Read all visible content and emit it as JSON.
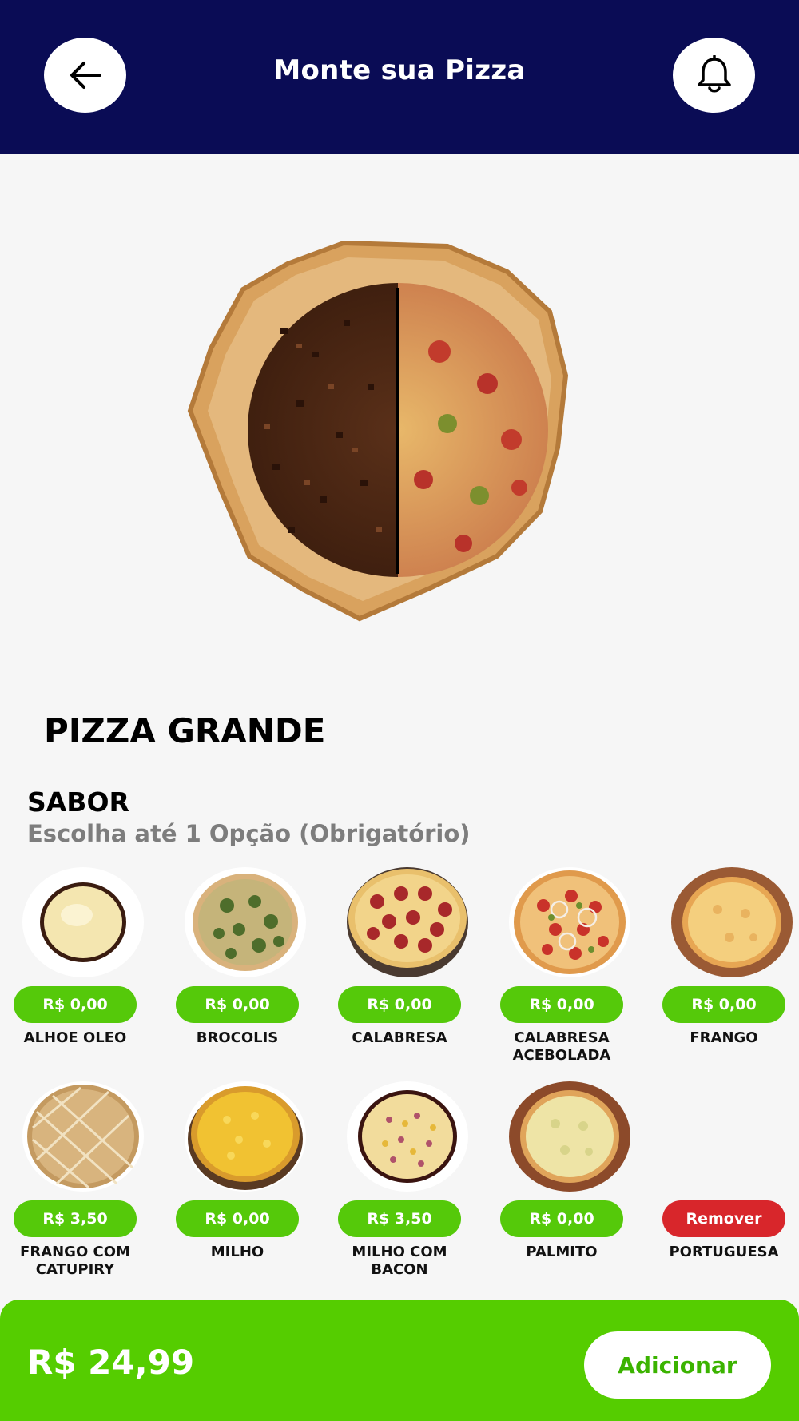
{
  "header": {
    "title": "Monte sua Pizza",
    "back_icon": "arrow-left-icon",
    "bell_icon": "bell-icon",
    "color": "#0a0c55"
  },
  "product": {
    "title": "PIZZA GRANDE"
  },
  "sabor": {
    "title": "SABOR",
    "subtitle": "Escolha até 1 Opção (Obrigatório)"
  },
  "flavors": [
    {
      "name": "ALHOE OLEO",
      "price": "R$ 0,00",
      "selected": false
    },
    {
      "name": "BROCOLIS",
      "price": "R$ 0,00",
      "selected": false
    },
    {
      "name": "CALABRESA",
      "price": "R$ 0,00",
      "selected": false
    },
    {
      "name": "CALABRESA ACEBOLADA",
      "price": "R$ 0,00",
      "selected": false
    },
    {
      "name": "FRANGO",
      "price": "R$ 0,00",
      "selected": false
    },
    {
      "name": "FRANGO COM CATUPIRY",
      "price": "R$ 3,50",
      "selected": false
    },
    {
      "name": "MILHO",
      "price": "R$ 0,00",
      "selected": false
    },
    {
      "name": "MILHO COM BACON",
      "price": "R$ 3,50",
      "selected": false
    },
    {
      "name": "PALMITO",
      "price": "R$ 0,00",
      "selected": false
    },
    {
      "name": "PORTUGUESA",
      "price": "Remover",
      "selected": true
    }
  ],
  "footer": {
    "total": "R$ 24,99",
    "add_label": "Adicionar",
    "color": "#55cd00"
  },
  "colors": {
    "price_green": "#55c90a",
    "remove_red": "#d8262b"
  }
}
